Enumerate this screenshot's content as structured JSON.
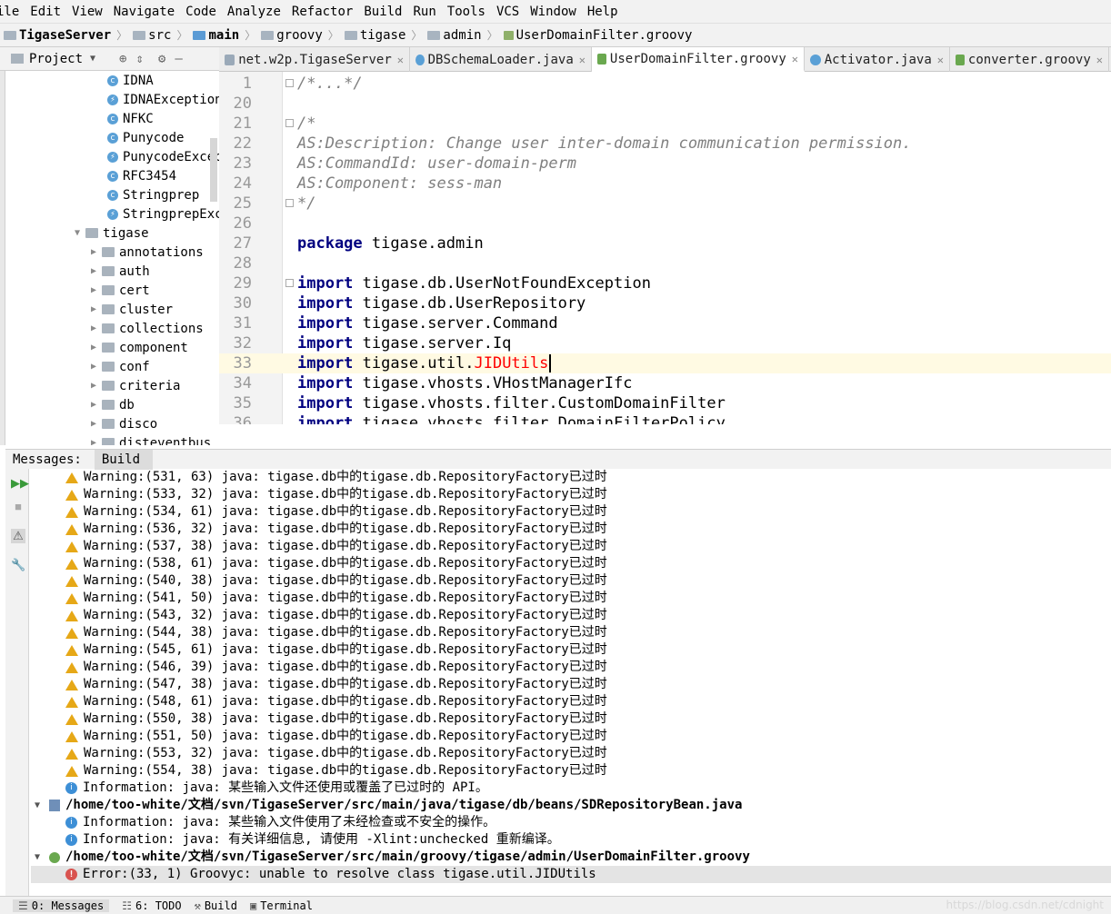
{
  "menu": [
    "ile",
    "Edit",
    "View",
    "Navigate",
    "Code",
    "Analyze",
    "Refactor",
    "Build",
    "Run",
    "Tools",
    "VCS",
    "Window",
    "Help"
  ],
  "breadcrumb": [
    "TigaseServer",
    "src",
    "main",
    "groovy",
    "tigase",
    "admin",
    "UserDomainFilter.groovy"
  ],
  "project_panel": {
    "title": "Project",
    "tree": [
      {
        "label": "IDNA",
        "kind": "class"
      },
      {
        "label": "IDNAException",
        "kind": "exception"
      },
      {
        "label": "NFKC",
        "kind": "class"
      },
      {
        "label": "Punycode",
        "kind": "class"
      },
      {
        "label": "PunycodeExcep",
        "kind": "exception"
      },
      {
        "label": "RFC3454",
        "kind": "class"
      },
      {
        "label": "Stringprep",
        "kind": "class"
      },
      {
        "label": "StringprepExc",
        "kind": "exception"
      },
      {
        "label": "tigase",
        "kind": "package-open"
      },
      {
        "label": "annotations",
        "kind": "package"
      },
      {
        "label": "auth",
        "kind": "package"
      },
      {
        "label": "cert",
        "kind": "package"
      },
      {
        "label": "cluster",
        "kind": "package"
      },
      {
        "label": "collections",
        "kind": "package"
      },
      {
        "label": "component",
        "kind": "package"
      },
      {
        "label": "conf",
        "kind": "package"
      },
      {
        "label": "criteria",
        "kind": "package"
      },
      {
        "label": "db",
        "kind": "package"
      },
      {
        "label": "disco",
        "kind": "package"
      },
      {
        "label": "disteventbus",
        "kind": "package"
      }
    ]
  },
  "tabs": [
    {
      "label": "net.w2p.TigaseServer",
      "icon": "module",
      "active": false
    },
    {
      "label": "DBSchemaLoader.java",
      "icon": "java",
      "active": false
    },
    {
      "label": "UserDomainFilter.groovy",
      "icon": "groovy",
      "active": true
    },
    {
      "label": "Activator.java",
      "icon": "java",
      "active": false
    },
    {
      "label": "converter.groovy",
      "icon": "groovy",
      "active": false
    }
  ],
  "editor": {
    "lines": [
      {
        "num": "1",
        "parts": [
          {
            "t": "/*...*/",
            "c": "cm"
          }
        ],
        "fold": true
      },
      {
        "num": "20",
        "parts": []
      },
      {
        "num": "21",
        "parts": [
          {
            "t": "/*",
            "c": "cm"
          }
        ],
        "fold": true
      },
      {
        "num": "22",
        "parts": [
          {
            "t": "AS:Description: Change user inter-domain communication permission.",
            "c": "cm"
          }
        ]
      },
      {
        "num": "23",
        "parts": [
          {
            "t": "AS:CommandId: user-domain-perm",
            "c": "cm"
          }
        ]
      },
      {
        "num": "24",
        "parts": [
          {
            "t": "AS:Component: sess-man",
            "c": "cm"
          }
        ]
      },
      {
        "num": "25",
        "parts": [
          {
            "t": "*/",
            "c": "cm"
          }
        ],
        "fold": true
      },
      {
        "num": "26",
        "parts": []
      },
      {
        "num": "27",
        "parts": [
          {
            "t": "package",
            "c": "kw"
          },
          {
            "t": " tigase.admin",
            "c": ""
          }
        ]
      },
      {
        "num": "28",
        "parts": []
      },
      {
        "num": "29",
        "parts": [
          {
            "t": "import",
            "c": "kw"
          },
          {
            "t": " tigase.db.UserNotFoundException",
            "c": ""
          }
        ],
        "fold": true
      },
      {
        "num": "30",
        "parts": [
          {
            "t": "import",
            "c": "kw"
          },
          {
            "t": " tigase.db.UserRepository",
            "c": ""
          }
        ]
      },
      {
        "num": "31",
        "parts": [
          {
            "t": "import",
            "c": "kw"
          },
          {
            "t": " tigase.server.Command",
            "c": ""
          }
        ]
      },
      {
        "num": "32",
        "parts": [
          {
            "t": "import",
            "c": "kw"
          },
          {
            "t": " tigase.server.Iq",
            "c": ""
          }
        ]
      },
      {
        "num": "33",
        "parts": [
          {
            "t": "import",
            "c": "kw"
          },
          {
            "t": " tigase.util.",
            "c": ""
          },
          {
            "t": "JIDUtils",
            "c": "err"
          }
        ],
        "current": true
      },
      {
        "num": "34",
        "parts": [
          {
            "t": "import",
            "c": "kw"
          },
          {
            "t": " tigase.vhosts.VHostManagerIfc",
            "c": ""
          }
        ]
      },
      {
        "num": "35",
        "parts": [
          {
            "t": "import",
            "c": "kw"
          },
          {
            "t": " tigase.vhosts.filter.CustomDomainFilter",
            "c": ""
          }
        ]
      },
      {
        "num": "36",
        "parts": [
          {
            "t": "import",
            "c": "kw"
          },
          {
            "t": " tigase.vhosts.filter.DomainFilterPolicy",
            "c": ""
          }
        ]
      }
    ]
  },
  "messages": {
    "header_label": "Messages:",
    "tab": "Build",
    "rows": [
      {
        "type": "warning",
        "text": "Warning:(531, 63)  java: tigase.db中的tigase.db.RepositoryFactory已过时"
      },
      {
        "type": "warning",
        "text": "Warning:(533, 32)  java: tigase.db中的tigase.db.RepositoryFactory已过时"
      },
      {
        "type": "warning",
        "text": "Warning:(534, 61)  java: tigase.db中的tigase.db.RepositoryFactory已过时"
      },
      {
        "type": "warning",
        "text": "Warning:(536, 32)  java: tigase.db中的tigase.db.RepositoryFactory已过时"
      },
      {
        "type": "warning",
        "text": "Warning:(537, 38)  java: tigase.db中的tigase.db.RepositoryFactory已过时"
      },
      {
        "type": "warning",
        "text": "Warning:(538, 61)  java: tigase.db中的tigase.db.RepositoryFactory已过时"
      },
      {
        "type": "warning",
        "text": "Warning:(540, 38)  java: tigase.db中的tigase.db.RepositoryFactory已过时"
      },
      {
        "type": "warning",
        "text": "Warning:(541, 50)  java: tigase.db中的tigase.db.RepositoryFactory已过时"
      },
      {
        "type": "warning",
        "text": "Warning:(543, 32)  java: tigase.db中的tigase.db.RepositoryFactory已过时"
      },
      {
        "type": "warning",
        "text": "Warning:(544, 38)  java: tigase.db中的tigase.db.RepositoryFactory已过时"
      },
      {
        "type": "warning",
        "text": "Warning:(545, 61)  java: tigase.db中的tigase.db.RepositoryFactory已过时"
      },
      {
        "type": "warning",
        "text": "Warning:(546, 39)  java: tigase.db中的tigase.db.RepositoryFactory已过时"
      },
      {
        "type": "warning",
        "text": "Warning:(547, 38)  java: tigase.db中的tigase.db.RepositoryFactory已过时"
      },
      {
        "type": "warning",
        "text": "Warning:(548, 61)  java: tigase.db中的tigase.db.RepositoryFactory已过时"
      },
      {
        "type": "warning",
        "text": "Warning:(550, 38)  java: tigase.db中的tigase.db.RepositoryFactory已过时"
      },
      {
        "type": "warning",
        "text": "Warning:(551, 50)  java: tigase.db中的tigase.db.RepositoryFactory已过时"
      },
      {
        "type": "warning",
        "text": "Warning:(553, 32)  java: tigase.db中的tigase.db.RepositoryFactory已过时"
      },
      {
        "type": "warning",
        "text": "Warning:(554, 38)  java: tigase.db中的tigase.db.RepositoryFactory已过时"
      },
      {
        "type": "info",
        "text": "Information: java: 某些输入文件还使用或覆盖了已过时的 API。"
      },
      {
        "type": "file",
        "text": "/home/too-white/文档/svn/TigaseServer/src/main/java/tigase/db/beans/SDRepositoryBean.java"
      },
      {
        "type": "info",
        "text": "Information: java: 某些输入文件使用了未经检查或不安全的操作。"
      },
      {
        "type": "info",
        "text": "Information: java: 有关详细信息, 请使用 -Xlint:unchecked 重新编译。"
      },
      {
        "type": "gfile",
        "text": "/home/too-white/文档/svn/TigaseServer/src/main/groovy/tigase/admin/UserDomainFilter.groovy"
      },
      {
        "type": "error",
        "text": "Error:(33, 1)  Groovyc: unable to resolve class tigase.util.JIDUtils"
      }
    ]
  },
  "statusbar": {
    "items": [
      "0: Messages",
      "6: TODO",
      "Build",
      "Terminal"
    ],
    "watermark": "https://blog.csdn.net/cdnight"
  },
  "colors": {
    "warning": "#e6a817",
    "info": "#3d8fd6",
    "error": "#d9534f",
    "keyword": "#000080",
    "comment": "#808080"
  }
}
